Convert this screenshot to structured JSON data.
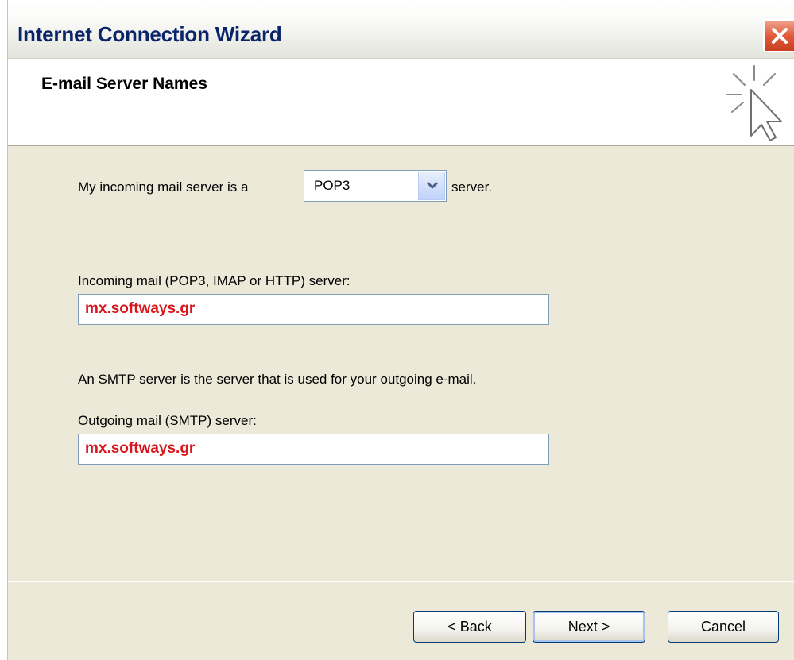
{
  "window": {
    "title": "Internet Connection Wizard"
  },
  "header": {
    "title": "E-mail Server Names"
  },
  "form": {
    "incoming_type_prefix": "My incoming mail server is a",
    "incoming_type_value": "POP3",
    "incoming_type_suffix": "server.",
    "incoming_label": "Incoming mail (POP3, IMAP or HTTP) server:",
    "incoming_value": "mx.softways.gr",
    "smtp_note": "An SMTP server is the server that is used for your outgoing e-mail.",
    "outgoing_label": "Outgoing mail (SMTP) server:",
    "outgoing_value": "mx.softways.gr"
  },
  "buttons": {
    "back": "< Back",
    "next": "Next >",
    "cancel": "Cancel"
  },
  "icons": {
    "close": "close-icon",
    "wizard": "wizard-cursor-icon",
    "dropdown": "chevron-down-icon"
  },
  "colors": {
    "value_text": "#d9161c",
    "title_text": "#0a246a",
    "dialog_bg": "#ece9d8"
  }
}
